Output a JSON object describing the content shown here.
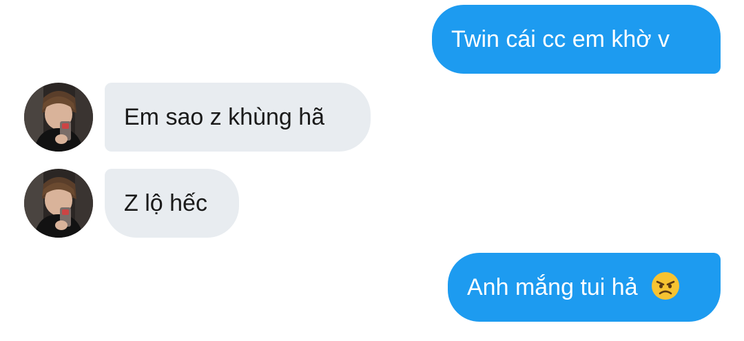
{
  "conversation": {
    "messages": [
      {
        "sender": "me",
        "text": "Twin cái cc em khờ v"
      },
      {
        "sender": "them",
        "text": "Em sao z khùng hã",
        "avatar": "avatar-photo"
      },
      {
        "sender": "them",
        "text": "Z lộ hếc",
        "avatar": "avatar-photo"
      },
      {
        "sender": "me",
        "text": "Anh mắng tui hả",
        "emoji": "angry-face-icon"
      }
    ]
  },
  "colors": {
    "outgoing_bubble": "#1d9bf0",
    "incoming_bubble": "#e8ecf0",
    "background": "#ffffff"
  }
}
